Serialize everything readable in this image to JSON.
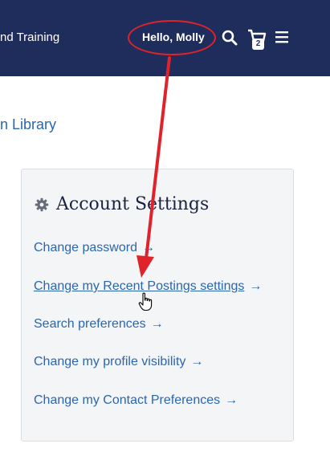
{
  "header": {
    "brand_partial": "nd Training",
    "greeting": "Hello, Molly",
    "cart_count": "2",
    "search_icon": "search-icon",
    "cart_icon": "cart-icon",
    "menu_icon": "hamburger-menu-icon"
  },
  "breadcrumb_link": "n Library",
  "account_settings": {
    "title": "Account Settings",
    "icon": "gear-icon",
    "links": [
      {
        "label": "Change password"
      },
      {
        "label": "Change my Recent Postings settings"
      },
      {
        "label": "Search preferences"
      },
      {
        "label": "Change my profile visibility"
      },
      {
        "label": "Change my Contact Preferences"
      }
    ],
    "arrow_glyph": "→"
  },
  "annotation": {
    "color": "#e0232a",
    "cursor": "hand-pointer-cursor"
  },
  "colors": {
    "header_bg": "#1f2d5c",
    "link": "#2a66b0",
    "panel_bg": "#f4f5f7"
  }
}
